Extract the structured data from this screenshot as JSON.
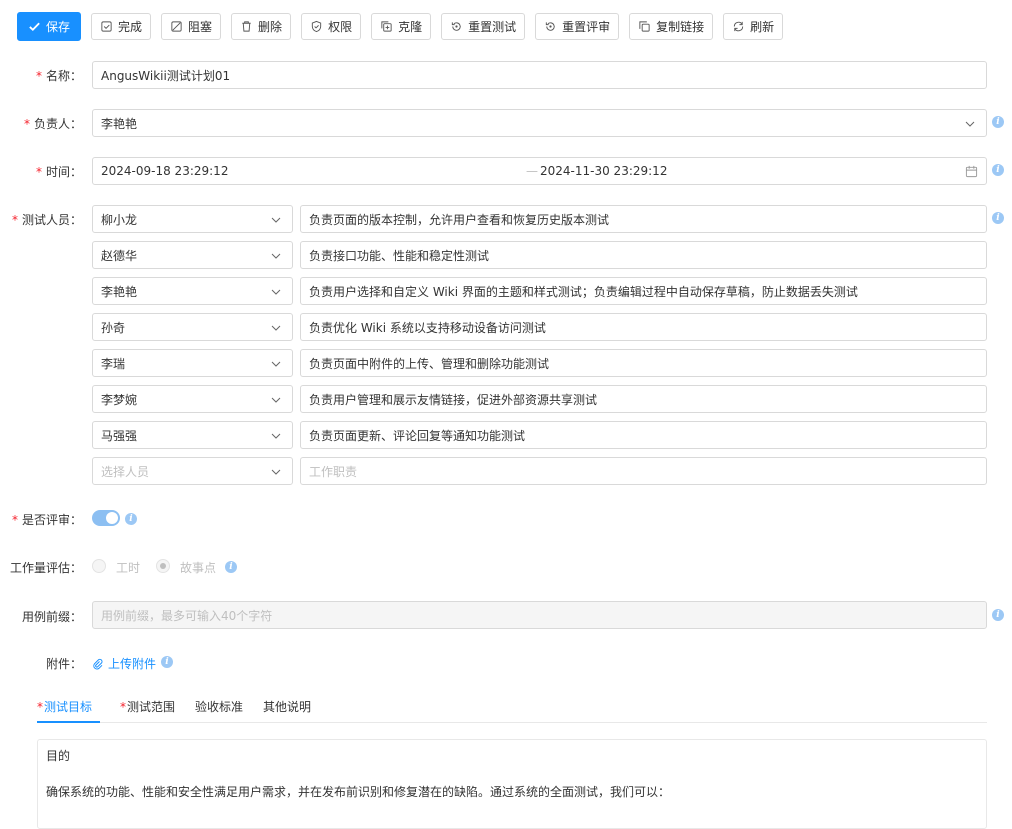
{
  "toolbar": {
    "save": "保存",
    "complete": "完成",
    "block": "阻塞",
    "delete": "删除",
    "permission": "权限",
    "clone": "克隆",
    "reset_test": "重置测试",
    "reset_review": "重置评审",
    "copy_link": "复制链接",
    "refresh": "刷新"
  },
  "form": {
    "name_label": "名称",
    "name_value": "AngusWikii测试计划01",
    "owner_label": "负责人",
    "owner_value": "李艳艳",
    "time_label": "时间",
    "time_start": "2024-09-18 23:29:12",
    "time_end": "2024-11-30 23:29:12",
    "time_sep": "—",
    "testers_label": "测试人员",
    "testers": [
      {
        "name": "柳小龙",
        "duty": "负责页面的版本控制，允许用户查看和恢复历史版本测试"
      },
      {
        "name": "赵德华",
        "duty": "负责接口功能、性能和稳定性测试"
      },
      {
        "name": "李艳艳",
        "duty": "负责用户选择和自定义 Wiki 界面的主题和样式测试；负责编辑过程中自动保存草稿，防止数据丢失测试"
      },
      {
        "name": "孙奇",
        "duty": "负责优化 Wiki 系统以支持移动设备访问测试"
      },
      {
        "name": "李瑞",
        "duty": "负责页面中附件的上传、管理和删除功能测试"
      },
      {
        "name": "李梦婉",
        "duty": "负责用户管理和展示友情链接，促进外部资源共享测试"
      },
      {
        "name": "马强强",
        "duty": "负责页面更新、评论回复等通知功能测试"
      }
    ],
    "tester_placeholder": "选择人员",
    "duty_placeholder": "工作职责",
    "review_label": "是否评审",
    "review_enabled": true,
    "workload_label": "工作量评估",
    "workload_options": [
      "工时",
      "故事点"
    ],
    "workload_selected": "故事点",
    "prefix_label": "用例前缀",
    "prefix_placeholder": "用例前缀，最多可输入40个字符",
    "attach_label": "附件",
    "attach_link": "上传附件",
    "label_colon": "："
  },
  "tabs": {
    "goal": "测试目标",
    "scope": "测试范围",
    "acceptance": "验收标准",
    "other": "其他说明",
    "active": "测试目标"
  },
  "editor": {
    "heading": "目的",
    "body": "确保系统的功能、性能和安全性满足用户需求，并在发布前识别和修复潜在的缺陷。通过系统的全面测试，我们可以："
  },
  "colors": {
    "primary": "#1890ff",
    "required": "#f5222d",
    "info": "#9cc8f5"
  }
}
